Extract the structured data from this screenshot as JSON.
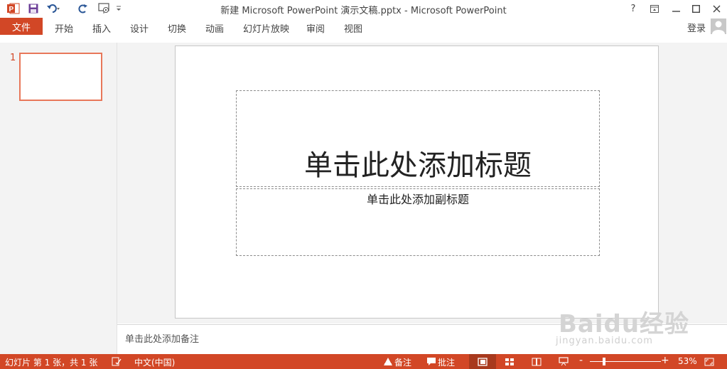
{
  "app": {
    "window_title": "新建 Microsoft PowerPoint 演示文稿.pptx - Microsoft PowerPoint",
    "accent_color": "#d24726"
  },
  "quick_access": [
    "powerpoint-logo-icon",
    "save-icon",
    "undo-icon",
    "redo-icon",
    "start-presentation-icon",
    "customize-qat-icon"
  ],
  "window_controls": {
    "help": "?",
    "ribbon_display": "ribbon-display-icon",
    "minimize": "minimize-icon",
    "maximize": "maximize-icon",
    "close": "close-icon"
  },
  "ribbon": {
    "file_tab": "文件",
    "tabs": [
      "开始",
      "插入",
      "设计",
      "切换",
      "动画",
      "幻灯片放映",
      "审阅",
      "视图"
    ],
    "sign_in": "登录"
  },
  "thumbnails": [
    {
      "number": "1"
    }
  ],
  "slide": {
    "title_placeholder": "单击此处添加标题",
    "subtitle_placeholder": "单击此处添加副标题"
  },
  "notes": {
    "placeholder": "单击此处添加备注"
  },
  "watermark": {
    "main": "Baidu经验",
    "sub": "jingyan.baidu.com"
  },
  "status_bar": {
    "slide_info": "幻灯片 第 1 张，共 1 张",
    "language": "中文(中国)",
    "notes_button": "备注",
    "comments_button": "批注",
    "zoom_minus": "-",
    "zoom_plus": "+",
    "zoom_level": "53%",
    "zoom_fraction": 0.53
  }
}
